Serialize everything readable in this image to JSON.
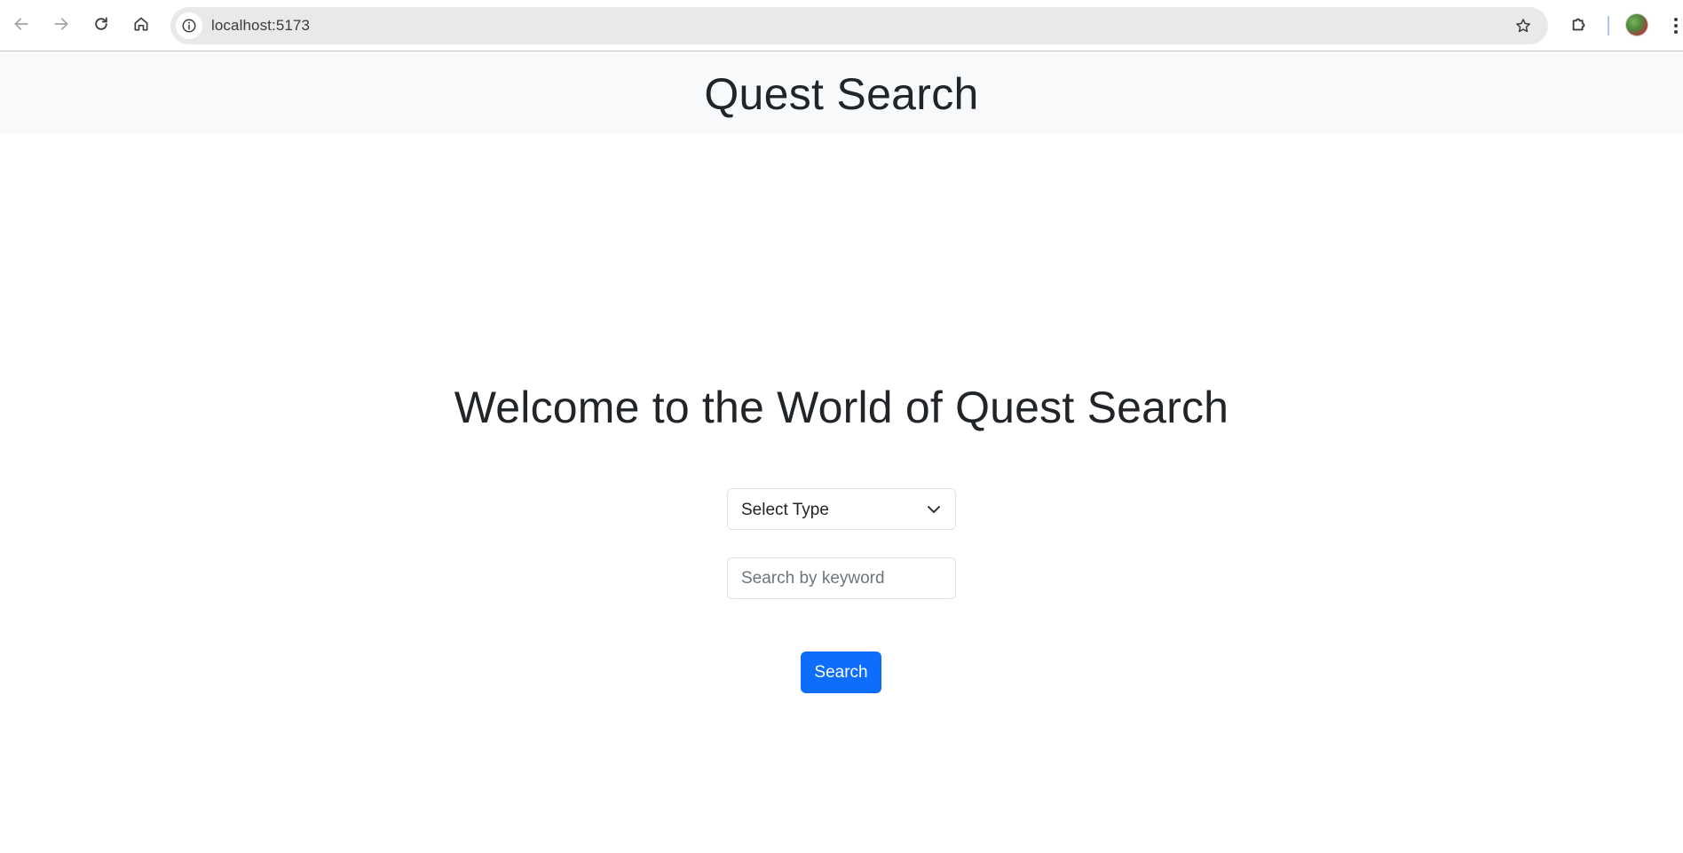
{
  "browser": {
    "url": "localhost:5173",
    "icons": {
      "back": "arrow-left-icon",
      "forward": "arrow-right-icon",
      "reload": "reload-icon",
      "home": "home-icon",
      "site_info": "info-icon",
      "bookmark": "star-icon",
      "extensions": "puzzle-icon",
      "menu": "kebab-menu-icon"
    }
  },
  "header": {
    "title": "Quest Search"
  },
  "main": {
    "welcome": "Welcome to the World of Quest Search",
    "type_select": {
      "selected": "Select Type"
    },
    "keyword_input": {
      "placeholder": "Search by keyword",
      "value": ""
    },
    "search_button": "Search"
  },
  "colors": {
    "primary": "#0d6efd",
    "header_bg": "#f8f9fa",
    "text": "#212529",
    "border": "#dee2e6"
  }
}
